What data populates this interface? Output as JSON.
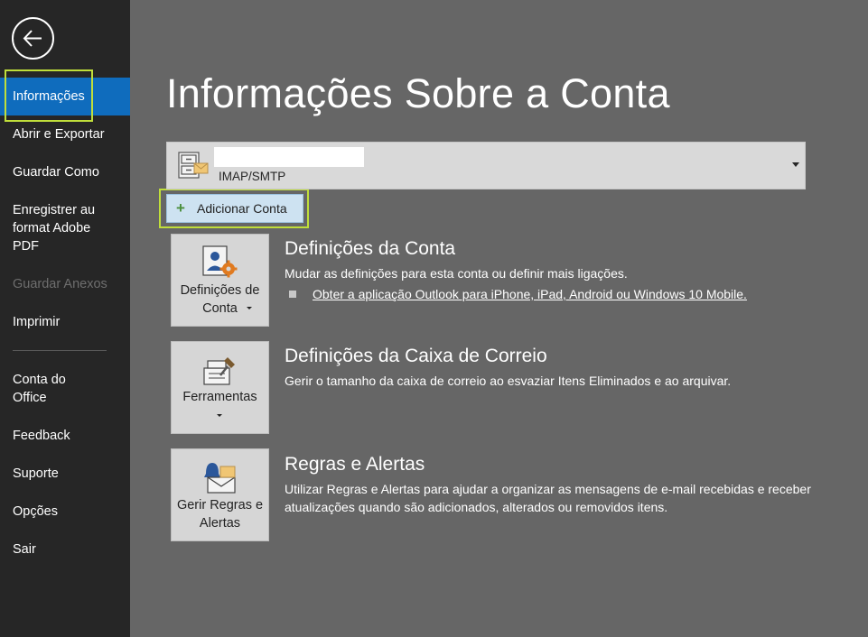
{
  "sidebar": {
    "back_icon": "back-arrow-icon",
    "items": [
      {
        "label": "Informações",
        "state": "active"
      },
      {
        "label": "Abrir e Exportar"
      },
      {
        "label": "Guardar Como"
      },
      {
        "label": "Enregistrer au format Adobe PDF"
      },
      {
        "label": "Guardar Anexos",
        "state": "disabled"
      },
      {
        "label": "Imprimir"
      },
      {
        "label": "Conta do Office"
      },
      {
        "label": "Feedback"
      },
      {
        "label": "Suporte"
      },
      {
        "label": "Opções"
      },
      {
        "label": "Sair"
      }
    ]
  },
  "main": {
    "title": "Informações Sobre a Conta",
    "account": {
      "type": "IMAP/SMTP",
      "icon": "account-mailbox-icon"
    },
    "add_account_label": "Adicionar Conta",
    "sections": [
      {
        "tile_label": "Definições de Conta",
        "tile_icon": "account-settings-icon",
        "title": "Definições da Conta",
        "description": "Mudar as definições para esta conta ou definir mais ligações.",
        "link": "Obter a aplicação Outlook para iPhone, iPad, Android ou Windows 10 Mobile."
      },
      {
        "tile_label": "Ferramentas",
        "tile_icon": "tools-icon",
        "title": "Definições da Caixa de Correio",
        "description": "Gerir o tamanho da caixa de correio ao esvaziar Itens Eliminados e ao arquivar."
      },
      {
        "tile_label": "Gerir Regras e Alertas",
        "tile_icon": "rules-alerts-icon",
        "title": "Regras e Alertas",
        "description": "Utilizar Regras e Alertas para ajudar a organizar as mensagens de e-mail recebidas e receber atualizações quando são adicionados, alterados ou removidos itens."
      }
    ]
  },
  "colors": {
    "sidebar_bg": "#262626",
    "main_bg": "#666666",
    "active_item": "#0f6cbd",
    "highlight_outline": "#c0de3a"
  }
}
